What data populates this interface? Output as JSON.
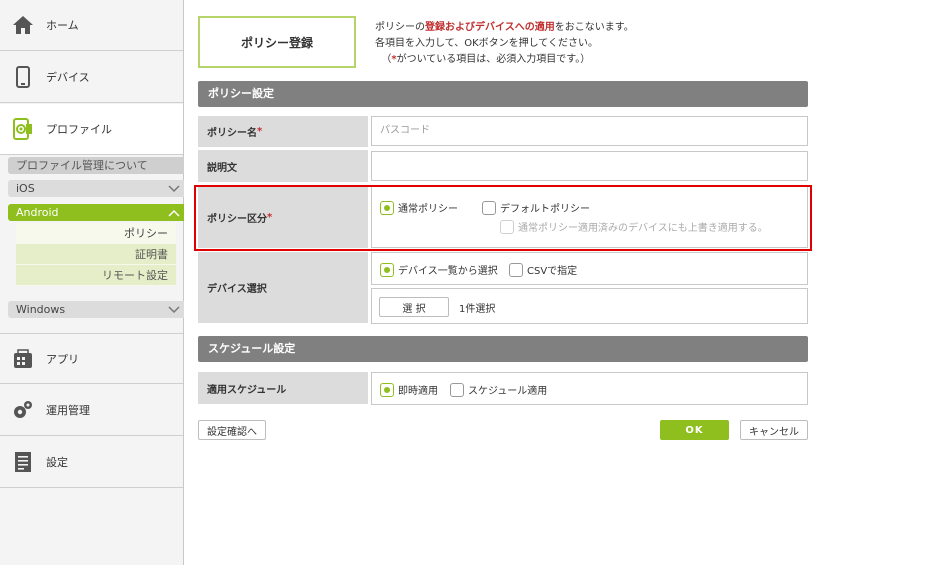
{
  "sidebar": {
    "nav": {
      "home": "ホーム",
      "devices": "デバイス",
      "profiles": "プロファイル",
      "apps": "アプリ",
      "operations": "運用管理",
      "settings": "設定"
    },
    "profile_about": "プロファイル管理について",
    "ios": "iOS",
    "android": "Android",
    "android_items": [
      "ポリシー",
      "証明書",
      "リモート設定"
    ],
    "windows": "Windows"
  },
  "page": {
    "title": "ポリシー登録",
    "intro_pre": "ポリシーの",
    "intro_highlight": "登録およびデバイスへの適用",
    "intro_post": "をおこないます。",
    "intro_line2": "各項目を入力して、OKボタンを押してください。",
    "intro_line3_open": "（",
    "intro_line3_star": "*",
    "intro_line3_rest": "がついている項目は、必須入力項目です。）"
  },
  "policy_section": {
    "heading": "ポリシー設定",
    "name_label": "ポリシー名",
    "required_mark": "*",
    "name_placeholder": "パスコード",
    "desc_label": "説明文",
    "type_label": "ポリシー区分",
    "type_normal": "通常ポリシー",
    "type_default": "デフォルトポリシー",
    "overwrite_option": "通常ポリシー適用済みのデバイスにも上書き適用する。",
    "device_label": "デバイス選択",
    "device_from_list": "デバイス一覧から選択",
    "device_csv": "CSVで指定",
    "select_button": "選 択",
    "selected_count": "1件選択"
  },
  "schedule_section": {
    "heading": "スケジュール設定",
    "apply_label": "適用スケジュール",
    "immediate": "即時適用",
    "scheduled": "スケジュール適用"
  },
  "actions": {
    "confirm": "設定確認へ",
    "ok": "OK",
    "cancel": "キャンセル"
  },
  "colors": {
    "accent": "#8fbf1f",
    "required": "#c03030",
    "highlight_border": "#e00000",
    "section_header": "#808080"
  }
}
